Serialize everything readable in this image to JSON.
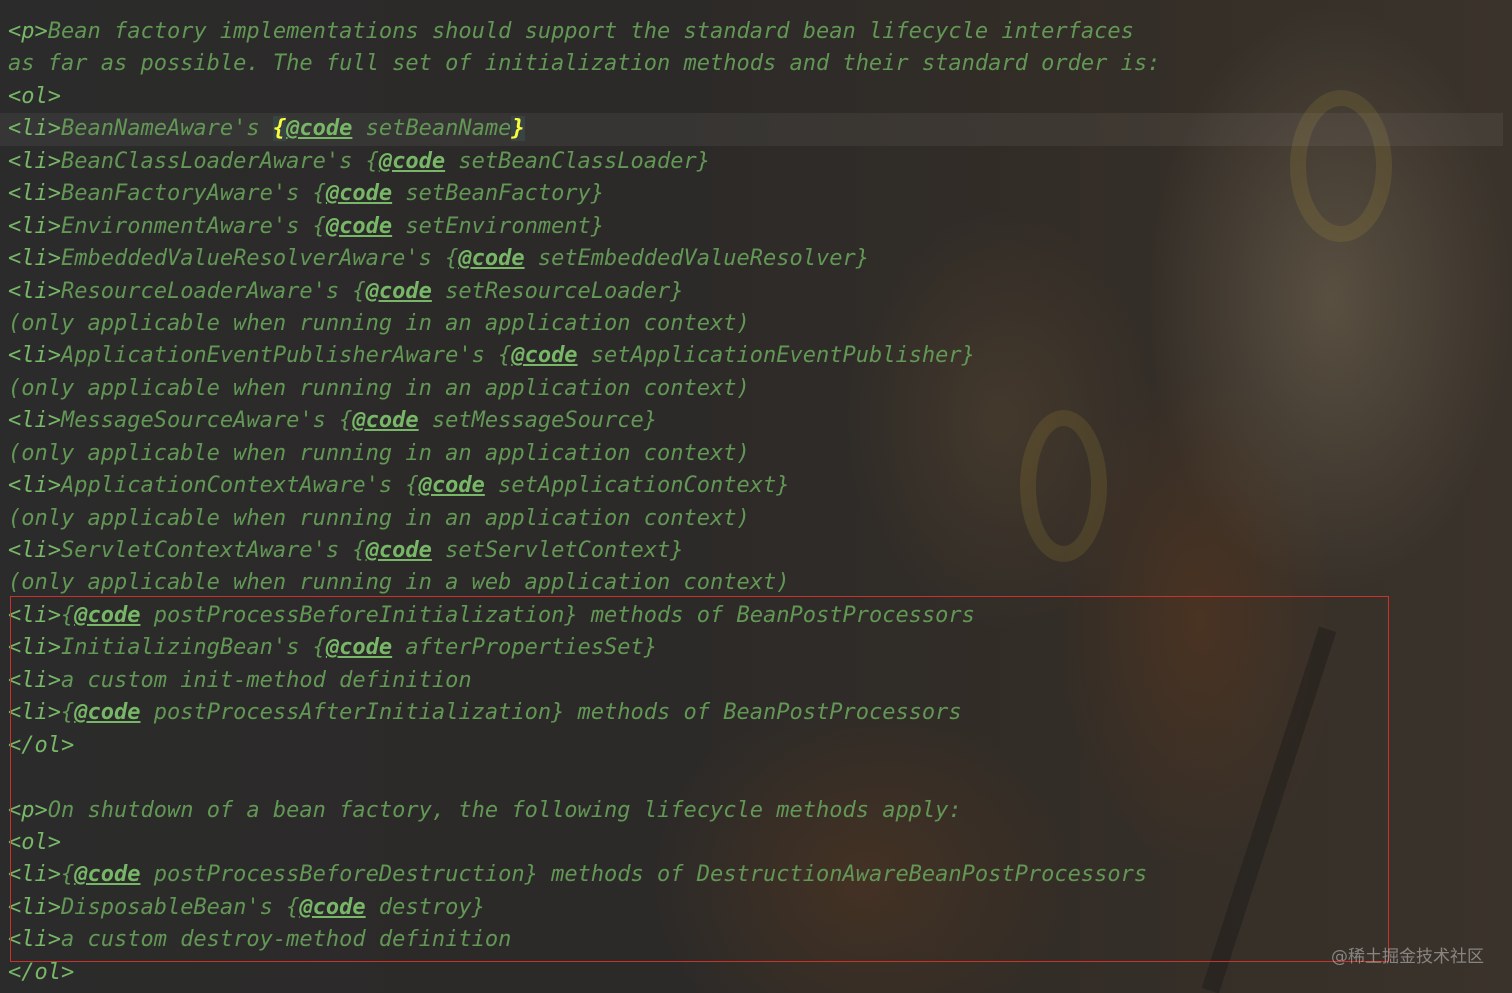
{
  "lines": [
    [
      "<p>",
      "Bean factory implementations should support the standard bean lifecycle interfaces"
    ],
    [
      "",
      "as far as possible. The full set of initialization methods and their standard order is:"
    ],
    [
      "<ol>",
      ""
    ],
    [
      "<li>",
      "BeanNameAware's ",
      "{",
      "@code",
      " setBeanName",
      "}"
    ],
    [
      "<li>",
      "BeanClassLoaderAware's {",
      "@code",
      " setBeanClassLoader}"
    ],
    [
      "<li>",
      "BeanFactoryAware's {",
      "@code",
      " setBeanFactory}"
    ],
    [
      "<li>",
      "EnvironmentAware's {",
      "@code",
      " setEnvironment}"
    ],
    [
      "<li>",
      "EmbeddedValueResolverAware's {",
      "@code",
      " setEmbeddedValueResolver}"
    ],
    [
      "<li>",
      "ResourceLoaderAware's {",
      "@code",
      " setResourceLoader}"
    ],
    [
      "",
      "(only applicable when running in an application context)"
    ],
    [
      "<li>",
      "ApplicationEventPublisherAware's {",
      "@code",
      " setApplicationEventPublisher}"
    ],
    [
      "",
      "(only applicable when running in an application context)"
    ],
    [
      "<li>",
      "MessageSourceAware's {",
      "@code",
      " setMessageSource}"
    ],
    [
      "",
      "(only applicable when running in an application context)"
    ],
    [
      "<li>",
      "ApplicationContextAware's {",
      "@code",
      " setApplicationContext}"
    ],
    [
      "",
      "(only applicable when running in an application context)"
    ],
    [
      "<li>",
      "ServletContextAware's {",
      "@code",
      " setServletContext}"
    ],
    [
      "",
      "(only applicable when running in a web application context)"
    ],
    [
      "<li>",
      "{",
      "@code",
      " postProcessBeforeInitialization} methods of BeanPostProcessors"
    ],
    [
      "<li>",
      "InitializingBean's {",
      "@code",
      " afterPropertiesSet}"
    ],
    [
      "<li>",
      "a custom init-method definition"
    ],
    [
      "<li>",
      "{",
      "@code",
      " postProcessAfterInitialization} methods of BeanPostProcessors"
    ],
    [
      "</ol>",
      ""
    ],
    [
      "",
      ""
    ],
    [
      "<p>",
      "On shutdown of a bean factory, the following lifecycle methods apply:"
    ],
    [
      "<ol>",
      ""
    ],
    [
      "<li>",
      "{",
      "@code",
      " postProcessBeforeDestruction} methods of DestructionAwareBeanPostProcessors"
    ],
    [
      "<li>",
      "DisposableBean's {",
      "@code",
      " destroy}"
    ],
    [
      "<li>",
      "a custom destroy-method definition"
    ],
    [
      "</ol>",
      ""
    ]
  ],
  "watermark": "@稀土掘金技术社区",
  "colors": {
    "background": "#2b2b2b",
    "doc_comment": "#629755",
    "doc_tag": "#77b767",
    "brace_match": "#fbfb3e",
    "highlight_box": "#c8322a"
  }
}
